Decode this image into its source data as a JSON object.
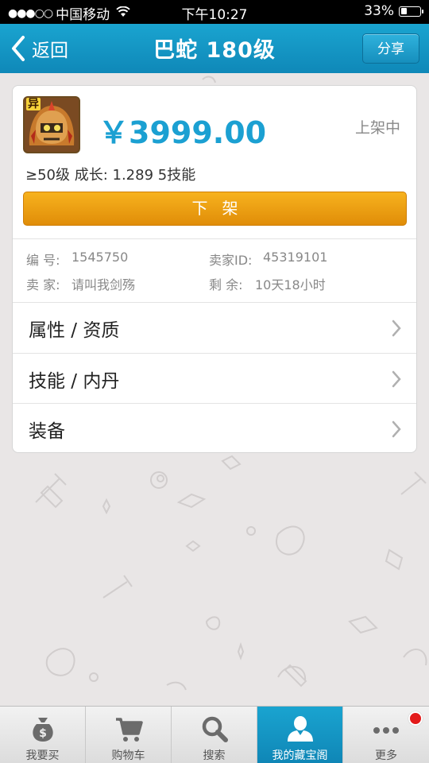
{
  "status_bar": {
    "signal": "●●●○○",
    "carrier": "中国移动",
    "time": "下午10:27",
    "battery": "33%",
    "battery_level": 0.33
  },
  "nav": {
    "back_label": "返回",
    "title": "巴蛇 180级",
    "share_label": "分享"
  },
  "item": {
    "avatar_badge": "异",
    "price": "￥3999.00",
    "status": "上架中",
    "stats": "≥50级 成长: 1.289  5技能",
    "delist_label": "下架",
    "info": {
      "serial_label": "编  号:",
      "serial_value": "1545750",
      "seller_id_label": "卖家ID:",
      "seller_id_value": "45319101",
      "seller_label": "卖  家:",
      "seller_value": "请叫我剑殇",
      "remaining_label": "剩  余:",
      "remaining_value": "10天18小时"
    }
  },
  "menu": [
    {
      "label": "属性 / 资质"
    },
    {
      "label": "技能 / 内丹"
    },
    {
      "label": "装备"
    }
  ],
  "tabs": [
    {
      "label": "我要买",
      "icon": "money-bag-icon"
    },
    {
      "label": "购物车",
      "icon": "cart-icon"
    },
    {
      "label": "搜索",
      "icon": "search-icon"
    },
    {
      "label": "我的藏宝阁",
      "icon": "user-icon",
      "active": true
    },
    {
      "label": "更多",
      "icon": "more-icon"
    }
  ],
  "colors": {
    "accent": "#1ba0d2",
    "button_orange": "#f0a114",
    "badge_red": "#e31a1a"
  }
}
